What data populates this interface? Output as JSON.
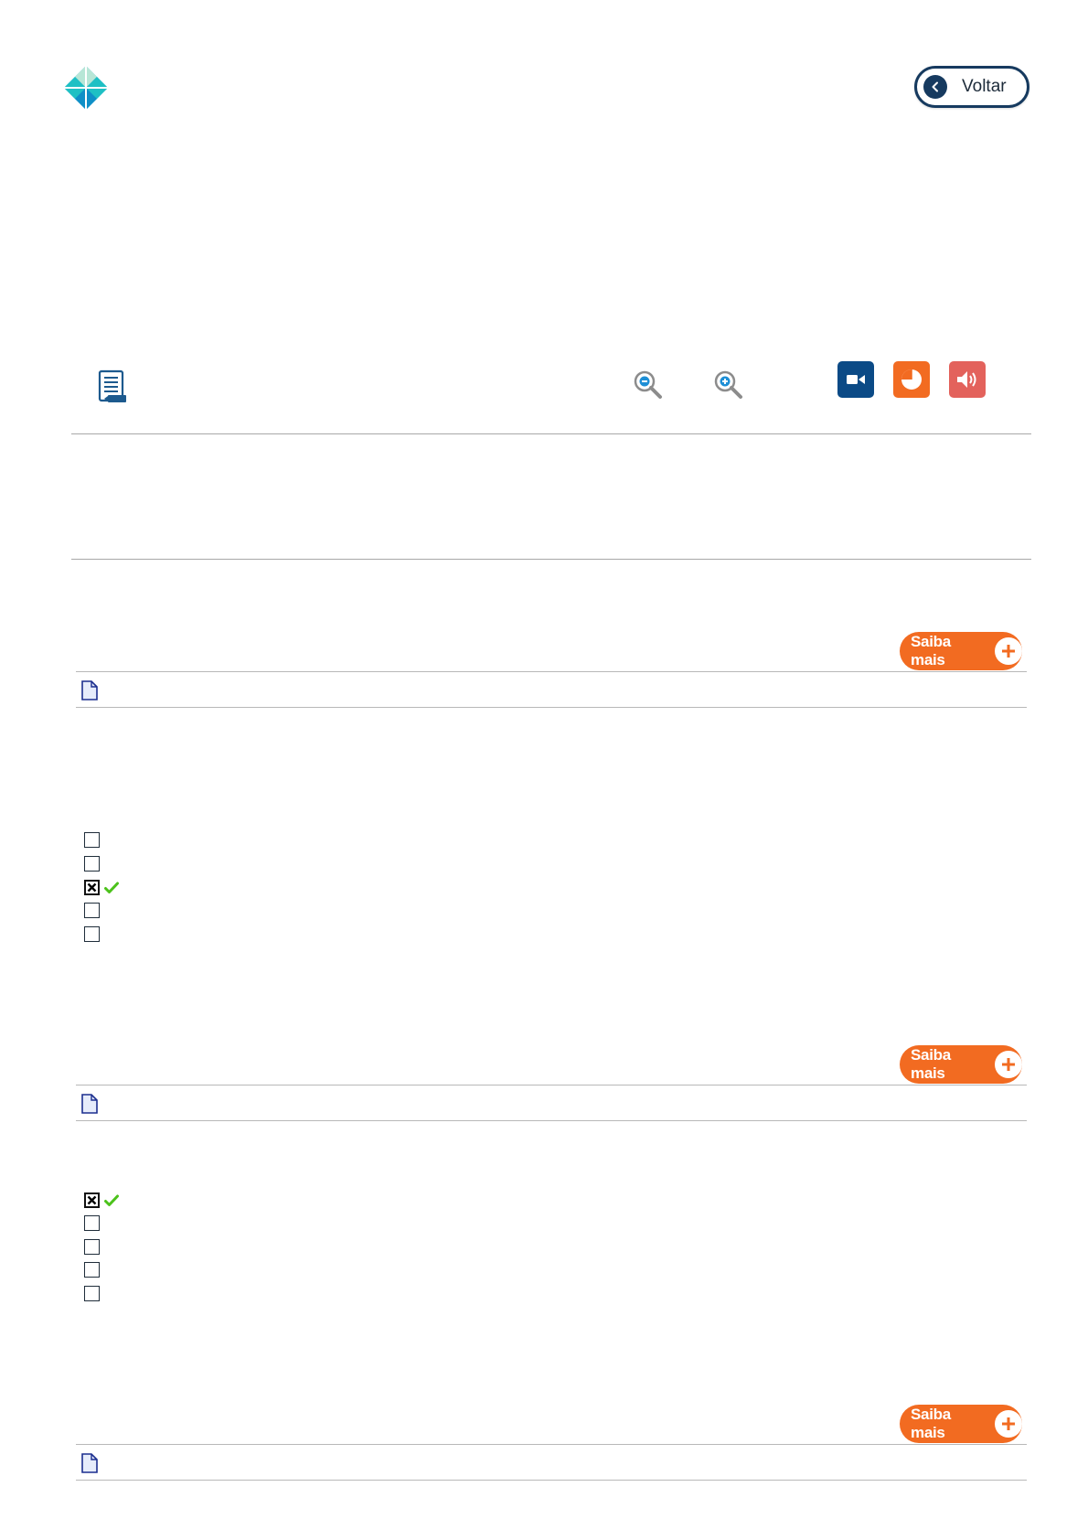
{
  "header": {
    "logo_icon": "logo-diamond-icon",
    "back_button_label": "Voltar",
    "back_icon": "chevron-left-icon"
  },
  "toolbar": {
    "doc_list_icon": "document-list-icon",
    "zoom_out_icon": "zoom-out-icon",
    "zoom_in_icon": "zoom-in-icon",
    "video_icon": "video-camera-icon",
    "chart_icon": "pie-chart-icon",
    "audio_icon": "speaker-icon"
  },
  "colors": {
    "navy": "#163a5f",
    "video_bg": "#0b4a86",
    "chart_bg": "#f26b21",
    "audio_bg": "#e3625c",
    "saiba_bg": "#f26b21",
    "check_green": "#4cc21b"
  },
  "questions": [
    {
      "saiba_label": "Saiba mais",
      "doc_icon": "document-icon"
    },
    {
      "saiba_label": "Saiba mais",
      "doc_icon": "document-icon",
      "options_checked": [
        false,
        false,
        true,
        false,
        false
      ]
    },
    {
      "saiba_label": "Saiba mais",
      "doc_icon": "document-icon",
      "options_checked": [
        true,
        false,
        false,
        false,
        false
      ]
    }
  ]
}
